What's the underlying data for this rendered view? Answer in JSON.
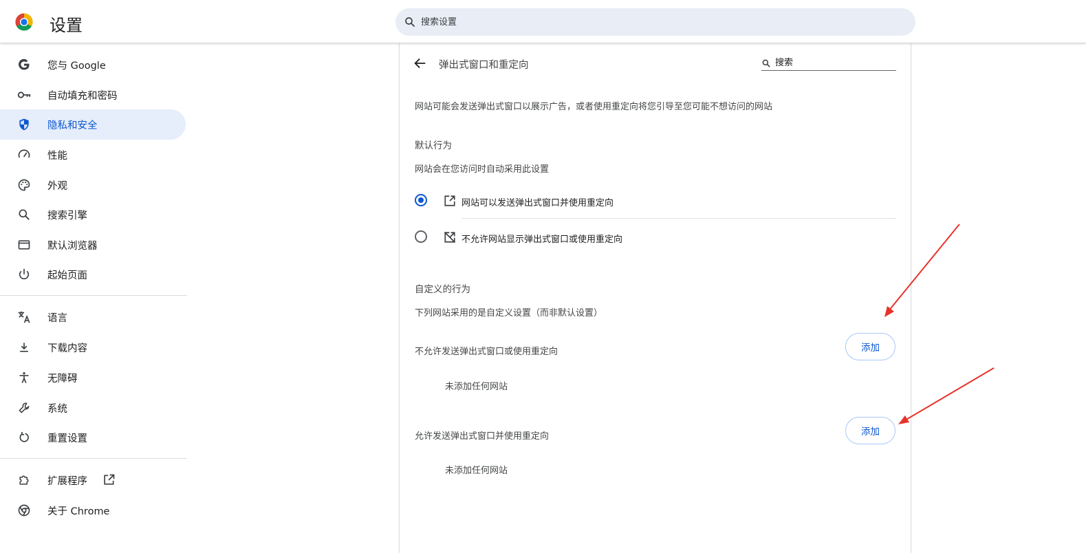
{
  "header": {
    "app_title": "设置",
    "search_placeholder": "搜索设置"
  },
  "sidebar": {
    "items": [
      {
        "label": "您与 Google",
        "icon": "google-g-icon"
      },
      {
        "label": "自动填充和密码",
        "icon": "key-icon"
      },
      {
        "label": "隐私和安全",
        "icon": "shield-icon",
        "active": true
      },
      {
        "label": "性能",
        "icon": "speedometer-icon"
      },
      {
        "label": "外观",
        "icon": "palette-icon"
      },
      {
        "label": "搜索引擎",
        "icon": "search-icon"
      },
      {
        "label": "默认浏览器",
        "icon": "browser-window-icon"
      },
      {
        "label": "起始页面",
        "icon": "power-icon"
      },
      {
        "label": "语言",
        "icon": "translate-icon"
      },
      {
        "label": "下载内容",
        "icon": "download-icon"
      },
      {
        "label": "无障碍",
        "icon": "accessibility-icon"
      },
      {
        "label": "系统",
        "icon": "wrench-icon"
      },
      {
        "label": "重置设置",
        "icon": "reset-icon"
      },
      {
        "label": "扩展程序",
        "icon": "puzzle-icon"
      },
      {
        "label": "关于 Chrome",
        "icon": "chrome-icon"
      }
    ]
  },
  "main": {
    "title": "弹出式窗口和重定向",
    "search_placeholder": "搜索",
    "description": "网站可能会发送弹出式窗口以展示广告，或者使用重定向将您引导至您可能不想访问的网站",
    "default_behavior": {
      "heading": "默认行为",
      "subheading": "网站会在您访问时自动采用此设置",
      "options": [
        {
          "label": "网站可以发送弹出式窗口并使用重定向",
          "checked": true
        },
        {
          "label": "不允许网站显示弹出式窗口或使用重定向",
          "checked": false
        }
      ]
    },
    "custom_behavior": {
      "heading": "自定义的行为",
      "subheading": "下列网站采用的是自定义设置（而非默认设置）",
      "lists": [
        {
          "label": "不允许发送弹出式窗口或使用重定向",
          "add_label": "添加",
          "empty_text": "未添加任何网站"
        },
        {
          "label": "允许发送弹出式窗口并使用重定向",
          "add_label": "添加",
          "empty_text": "未添加任何网站"
        }
      ]
    }
  },
  "colors": {
    "accent": "#0b57d0",
    "active_bg": "#e6edfb",
    "annotation_arrow": "#e8322b"
  }
}
